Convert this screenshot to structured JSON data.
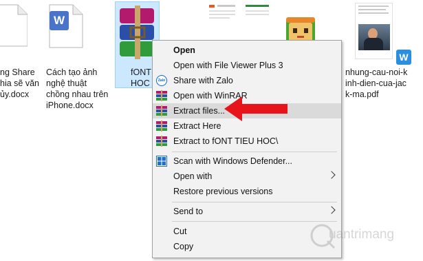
{
  "files": [
    {
      "label_lines": [
        "ng Share",
        "hia sẽ văn",
        "ủy.docx"
      ]
    },
    {
      "label_lines": [
        "Cách tạo ảnh",
        "nghệ thuật",
        "chồng nhau trên",
        "iPhone.docx"
      ]
    },
    {
      "label_lines": [
        "fONT",
        "HOC"
      ]
    },
    {
      "label_lines": [
        "nhung-cau-noi-k",
        "inh-dien-cua-jac",
        "k-ma.pdf"
      ]
    }
  ],
  "word_badge": "W",
  "menu": {
    "items": [
      {
        "label": "Open"
      },
      {
        "label": "Open with File Viewer Plus 3"
      },
      {
        "label": "Share with Zalo",
        "icon_text": "Zalo"
      },
      {
        "label": "Open with WinRAR"
      },
      {
        "label": "Extract files..."
      },
      {
        "label": "Extract Here"
      },
      {
        "label": "Extract to fONT TIEU HOC\\"
      },
      {
        "label": "Scan with Windows Defender..."
      },
      {
        "label": "Open with"
      },
      {
        "label": "Restore previous versions"
      },
      {
        "label": "Send to"
      },
      {
        "label": "Cut"
      },
      {
        "label": "Copy"
      }
    ]
  },
  "watermark": {
    "text": "uantrimang"
  },
  "colors": {
    "menu_bg": "#f2f2f2",
    "highlight": "#dadada",
    "selection": "#cce8ff",
    "arrow": "#e8141b",
    "word_blue": "#4a74c9"
  }
}
